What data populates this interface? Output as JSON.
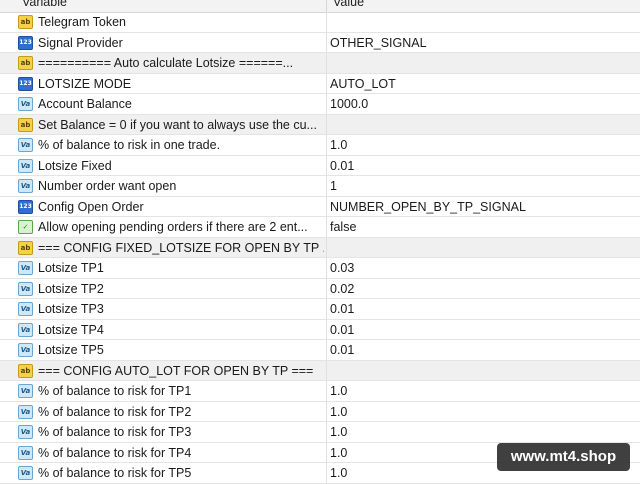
{
  "header": {
    "variable": "Variable",
    "value": "Value"
  },
  "rows": [
    {
      "icon": "ab-string-icon",
      "type": "ab",
      "label": "Telegram Token",
      "value": ""
    },
    {
      "icon": "number-icon",
      "type": "num",
      "label": "Signal Provider",
      "value": "OTHER_SIGNAL"
    },
    {
      "icon": "ab-string-icon",
      "type": "ab",
      "label": "========== Auto calculate Lotsize ======...",
      "value": "",
      "section": true
    },
    {
      "icon": "number-icon",
      "type": "num",
      "label": "LOTSIZE MODE",
      "value": "AUTO_LOT"
    },
    {
      "icon": "double-icon",
      "type": "va",
      "label": "Account Balance",
      "value": "1000.0"
    },
    {
      "icon": "ab-string-icon",
      "type": "ab",
      "label": "Set Balance = 0 if you want to always use the cu...",
      "value": "",
      "section": true
    },
    {
      "icon": "double-icon",
      "type": "va",
      "label": "% of balance to risk in one trade.",
      "value": "1.0"
    },
    {
      "icon": "double-icon",
      "type": "va",
      "label": "Lotsize Fixed",
      "value": "0.01"
    },
    {
      "icon": "double-icon",
      "type": "va",
      "label": "Number order want open",
      "value": "1"
    },
    {
      "icon": "number-icon",
      "type": "num",
      "label": "Config Open Order",
      "value": "NUMBER_OPEN_BY_TP_SIGNAL"
    },
    {
      "icon": "bool-icon",
      "type": "bool",
      "label": "Allow opening pending orders if there are 2 ent...",
      "value": "false"
    },
    {
      "icon": "ab-string-icon",
      "type": "ab",
      "label": "=== CONFIG FIXED_LOTSIZE FOR OPEN BY TP ...",
      "value": "",
      "section": true
    },
    {
      "icon": "double-icon",
      "type": "va",
      "label": "Lotsize TP1",
      "value": "0.03"
    },
    {
      "icon": "double-icon",
      "type": "va",
      "label": "Lotsize TP2",
      "value": "0.02"
    },
    {
      "icon": "double-icon",
      "type": "va",
      "label": "Lotsize TP3",
      "value": "0.01"
    },
    {
      "icon": "double-icon",
      "type": "va",
      "label": "Lotsize TP4",
      "value": "0.01"
    },
    {
      "icon": "double-icon",
      "type": "va",
      "label": "Lotsize TP5",
      "value": "0.01"
    },
    {
      "icon": "ab-string-icon",
      "type": "ab",
      "label": "=== CONFIG AUTO_LOT FOR OPEN BY TP ===",
      "value": "",
      "section": true
    },
    {
      "icon": "double-icon",
      "type": "va",
      "label": "% of balance to risk for TP1",
      "value": "1.0"
    },
    {
      "icon": "double-icon",
      "type": "va",
      "label": "% of balance to risk for TP2",
      "value": "1.0"
    },
    {
      "icon": "double-icon",
      "type": "va",
      "label": "% of balance to risk for TP3",
      "value": "1.0"
    },
    {
      "icon": "double-icon",
      "type": "va",
      "label": "% of balance to risk for TP4",
      "value": "1.0"
    },
    {
      "icon": "double-icon",
      "type": "va",
      "label": "% of balance to risk for TP5",
      "value": "1.0"
    }
  ],
  "icon_glyphs": {
    "ab": "ab",
    "num": "123",
    "va": "Va",
    "bool": "✓"
  },
  "watermark": "www.mt4.shop"
}
